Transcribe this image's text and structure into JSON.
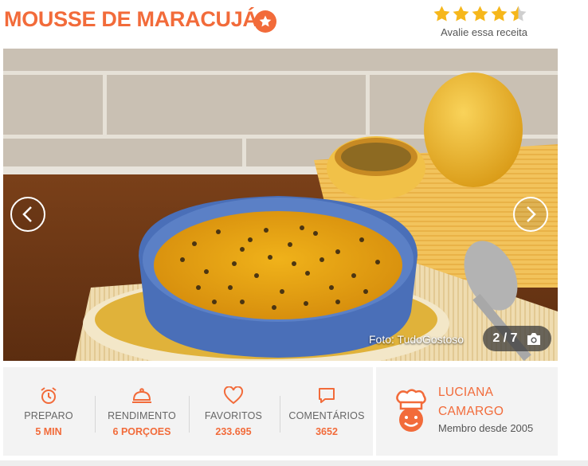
{
  "recipe": {
    "title": "MOUSSE DE MARACUJÁ",
    "rating": {
      "value": 4.5,
      "max": 5,
      "label": "Avalie essa receita"
    }
  },
  "gallery": {
    "credit": "Foto: TudoGostoso",
    "counter": "2 / 7",
    "image_description": "icon-names: chevron-left-icon, chevron-right-icon, camera-icon"
  },
  "stats": [
    {
      "label": "PREPARO",
      "value": "5 MIN",
      "icon": "alarm-clock-icon"
    },
    {
      "label": "RENDIMENTO",
      "value": "6 PORÇOES",
      "icon": "cloche-icon"
    },
    {
      "label": "FAVORITOS",
      "value": "233.695",
      "icon": "heart-icon"
    },
    {
      "label": "COMENTÁRIOS",
      "value": "3652",
      "icon": "speech-bubble-icon"
    }
  ],
  "author": {
    "name_line1": "LUCIANA",
    "name_line2": "CAMARGO",
    "member_since": "Membro desde 2005",
    "avatar_icon": "chef-avatar-icon"
  },
  "colors": {
    "accent": "#f26b3a",
    "star": "#f6b71b",
    "panel": "#f3f3f3"
  }
}
